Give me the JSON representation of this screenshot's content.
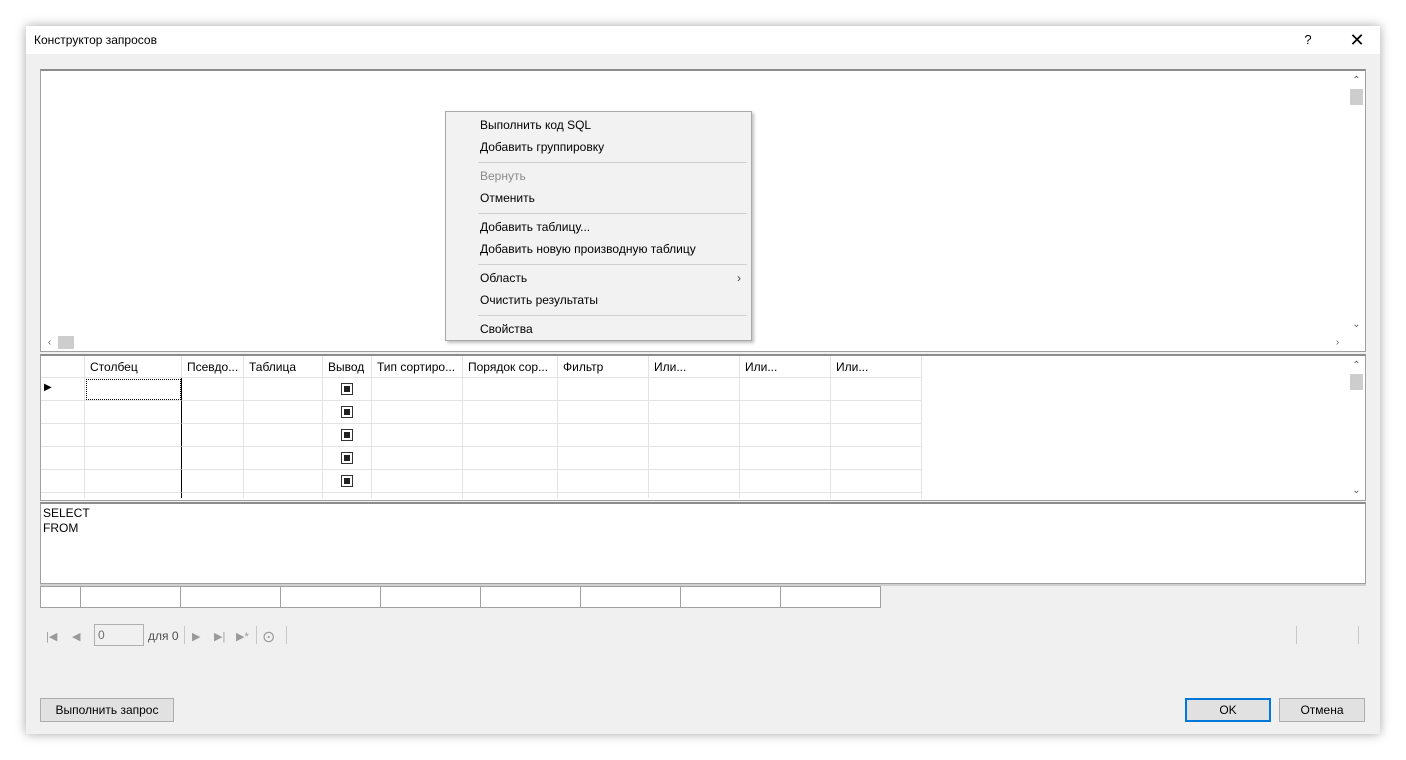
{
  "window": {
    "title": "Конструктор запросов",
    "help": "?",
    "close": "✕"
  },
  "context_menu": {
    "items": [
      {
        "label": "Выполнить код SQL",
        "enabled": true
      },
      {
        "label": "Добавить группировку",
        "enabled": true
      },
      {
        "label": "Вернуть",
        "enabled": false
      },
      {
        "label": "Отменить",
        "enabled": true
      },
      {
        "label": "Добавить таблицу...",
        "enabled": true
      },
      {
        "label": "Добавить новую производную таблицу",
        "enabled": true
      },
      {
        "label": "Область",
        "enabled": true,
        "submenu": true
      },
      {
        "label": "Очистить результаты",
        "enabled": true
      },
      {
        "label": "Свойства",
        "enabled": true
      }
    ],
    "submenu_arrow": "›"
  },
  "grid": {
    "columns": [
      "Столбец",
      "Псевдо...",
      "Таблица",
      "Вывод",
      "Тип сортиро...",
      "Порядок сор...",
      "Фильтр",
      "Или...",
      "Или...",
      "Или..."
    ],
    "row_indicator": "▶",
    "output_checked": [
      true,
      true,
      true,
      true,
      true
    ]
  },
  "sql": {
    "text": "SELECT\nFROM"
  },
  "navigator": {
    "position": "0",
    "of_label": "для 0"
  },
  "buttons": {
    "run_query": "Выполнить запрос",
    "ok": "OK",
    "cancel": "Отмена"
  },
  "colors": {
    "accent": "#0078d7",
    "dialog_bg": "#f0f0f0"
  }
}
